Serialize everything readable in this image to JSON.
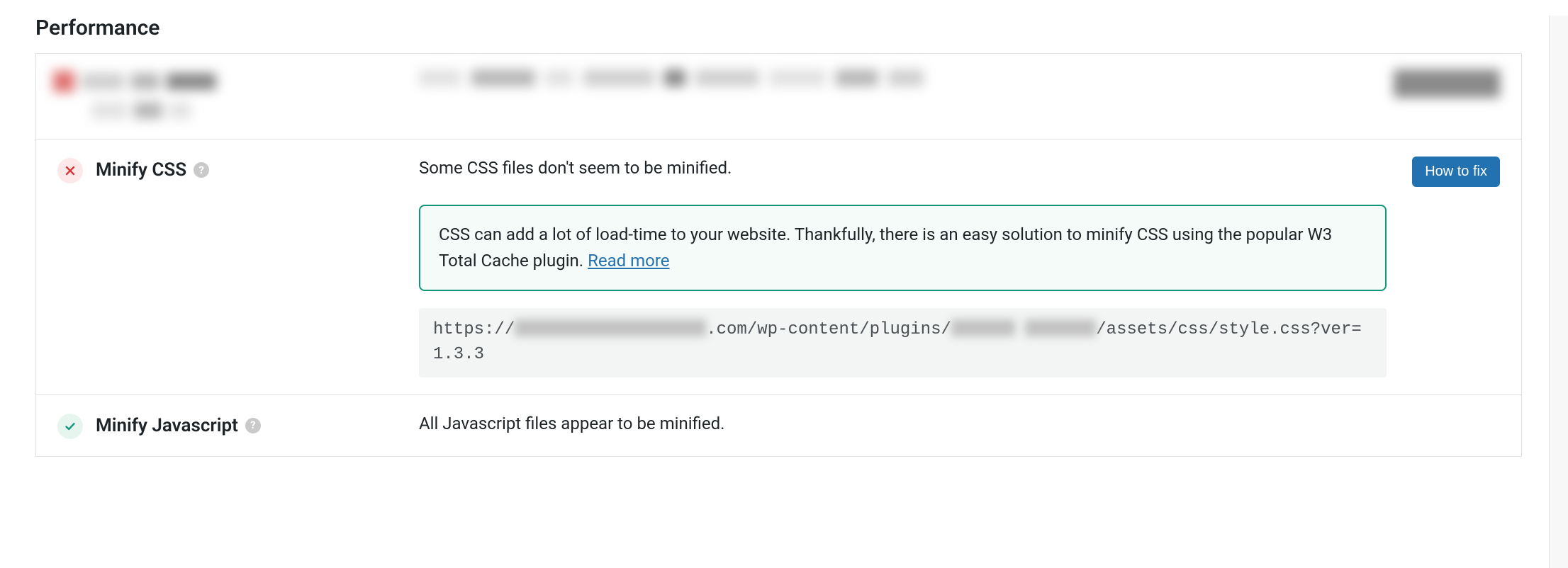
{
  "section_title": "Performance",
  "colors": {
    "accent": "#2271b1",
    "info_border": "#11967a",
    "fail_bg": "#fce8e8",
    "pass_bg": "#e6f6ee"
  },
  "items": [
    {
      "status": "redacted"
    },
    {
      "status": "fail",
      "title": "Minify CSS",
      "summary": "Some CSS files don't seem to be minified.",
      "button": "How to fix",
      "info_text": "CSS can add a lot of load-time to your website. Thankfully, there is an easy solution to minify CSS using the popular W3 Total Cache plugin. ",
      "info_link": "Read more",
      "code_parts": {
        "prefix": "https://",
        "mid1": ".com/wp-content/plugins/",
        "mid2": "/assets/css/style.css?ver=1.3.3"
      }
    },
    {
      "status": "pass",
      "title": "Minify Javascript",
      "summary": "All Javascript files appear to be minified."
    }
  ]
}
